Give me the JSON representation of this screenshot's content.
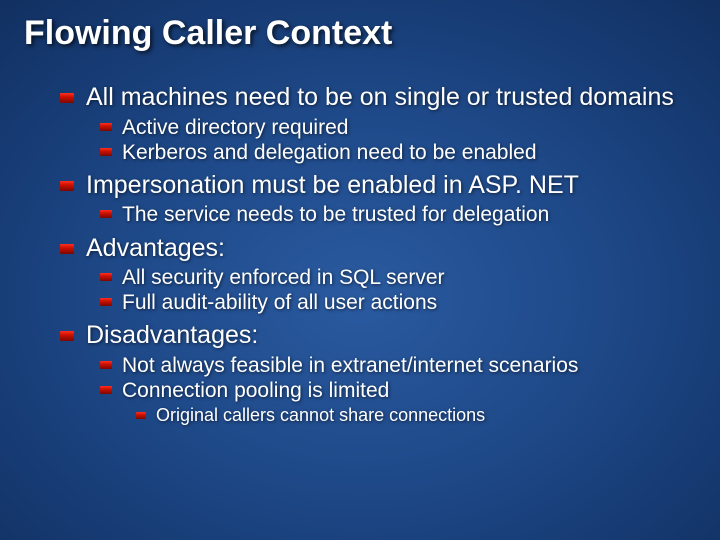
{
  "title": "Flowing Caller Context",
  "bullets": [
    {
      "text": "All machines need to be on single or trusted domains",
      "children": [
        {
          "text": "Active directory required"
        },
        {
          "text": "Kerberos and delegation need to be enabled"
        }
      ]
    },
    {
      "text": "Impersonation must be enabled in ASP. NET",
      "children": [
        {
          "text": "The service needs to be trusted for delegation"
        }
      ]
    },
    {
      "text": "Advantages:",
      "children": [
        {
          "text": "All security enforced in SQL server"
        },
        {
          "text": "Full audit-ability of all user actions"
        }
      ]
    },
    {
      "text": "Disadvantages:",
      "children": [
        {
          "text": "Not always feasible in extranet/internet scenarios"
        },
        {
          "text": "Connection pooling is limited",
          "children": [
            {
              "text": "Original callers cannot share connections"
            }
          ]
        }
      ]
    }
  ]
}
